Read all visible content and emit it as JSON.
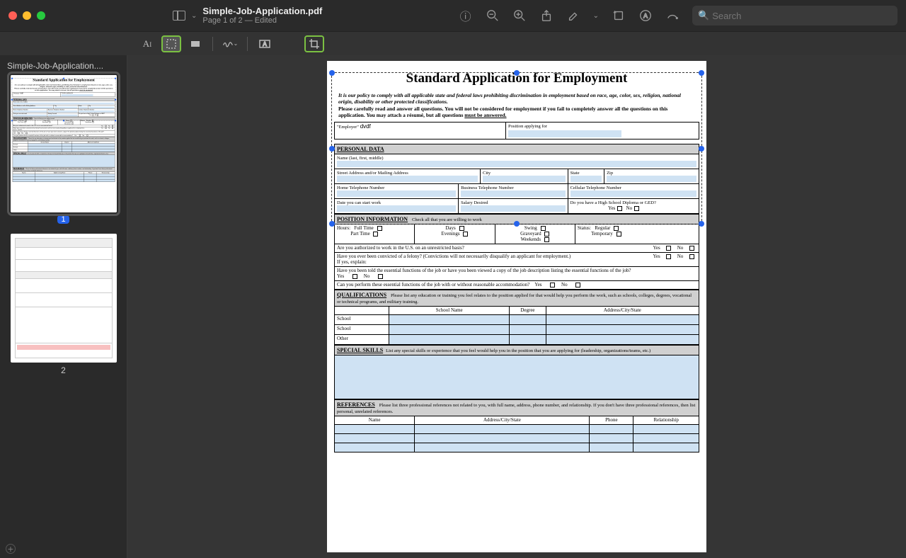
{
  "window": {
    "filename": "Simple-Job-Application.pdf",
    "subtitle": "Page 1 of 2 — Edited",
    "sidebar_filename": "Simple-Job-Application....",
    "search_placeholder": "Search"
  },
  "pages": {
    "p1": "1",
    "p2": "2"
  },
  "doc": {
    "title": "Standard Application for Employment",
    "intro1": "It is our policy to comply with all applicable state and federal laws prohibiting discrimination in employment based on race, age, color, sex, religion, national origin, disability or other protected classifications.",
    "intro2a": "Please carefully read and answer all questions. You will not be considered for employment if you fail to completely answer all the questions on this application. You may attach a résumé, but all questions ",
    "intro2b": "must be answered.",
    "employer_label": "\"Employer\"",
    "employer_value": "dvdf",
    "position_label": "Position applying for",
    "personal_data": "PERSONAL DATA",
    "name_label": "Name (last, first, middle)",
    "street": "Street Address and/or Mailing Address",
    "city": "City",
    "state": "State",
    "zip": "Zip",
    "home_tel": "Home Telephone Number",
    "bus_tel": "Business Telephone Number",
    "cell_tel": "Cellular Telephone Number",
    "start_date": "Date you can start work",
    "salary": "Salary Desired",
    "hs_diploma": "Do you have a High School Diploma or GED?",
    "yes": "Yes",
    "no": "No",
    "position_info": "POSITION INFORMATION",
    "check_all": "Check all that you are willing to work",
    "hours": "Hours:",
    "fulltime": "Full Time",
    "parttime": "Part Time",
    "days": "Days",
    "evenings": "Evenings",
    "swing": "Swing",
    "graveyard": "Graveyard",
    "weekends": "Weekends",
    "status": "Status:",
    "regular": "Regular",
    "temporary": "Temporary",
    "authorized": "Are you authorized to work in the U.S. on an unrestricted basis?",
    "felony": "Have you ever been convicted of a felony? (Convictions will not necessarily disqualify an applicant for employment.)",
    "explain": "If yes, explain:",
    "essential": "Have you been told the essential functions of the job or have you been viewed a copy of the job description listing the essential functions of the job?",
    "accommodate": "Can you perform these essential functions of the job with or without reasonable accommodation?",
    "qualifications": "QUALIFICATIONS",
    "qual_desc": "Please list any education or training you feel relates to the position applied for that would help you perform the work, such as schools, colleges, degrees, vocational or technical programs, and military training.",
    "school_name": "School Name",
    "degree": "Degree",
    "address_city_state": "Address/City/State",
    "school": "School",
    "other": "Other",
    "special_skills": "SPECIAL SKILLS",
    "skills_desc": "List any special skills or experience that you feel would help you in the position that you are applying for (leadership, organizations/teams, etc.)",
    "references": "REFERENCES",
    "ref_desc": "Please list three professional references not related to you, with full name, address, phone number, and relationship.  If you don't have three professional references, then list personal, unrelated references.",
    "ref_name": "Name",
    "ref_addr": "Address/City/State",
    "ref_phone": "Phone",
    "ref_rel": "Relationship"
  }
}
